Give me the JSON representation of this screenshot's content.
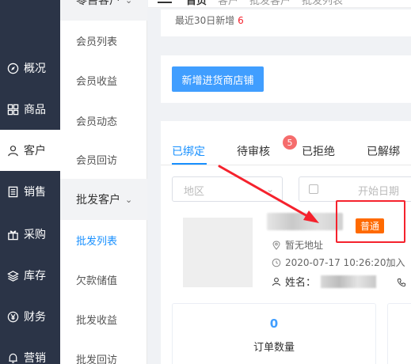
{
  "sidebar_main": {
    "items": [
      {
        "label": "概况",
        "icon": "compass-icon"
      },
      {
        "label": "商品",
        "icon": "grid-icon"
      },
      {
        "label": "客户",
        "icon": "user-icon"
      },
      {
        "label": "销售",
        "icon": "document-icon"
      },
      {
        "label": "采购",
        "icon": "gift-icon"
      },
      {
        "label": "库存",
        "icon": "layers-icon"
      },
      {
        "label": "财务",
        "icon": "yen-icon"
      },
      {
        "label": "营销",
        "icon": "bell-icon"
      }
    ],
    "active_index": 2
  },
  "sidebar_sub": {
    "group_retail": "零售客户",
    "retail_items": [
      "会员列表",
      "会员收益",
      "会员动态",
      "会员回访"
    ],
    "group_wholesale": "批发客户",
    "wholesale_items": [
      "批发列表",
      "欠款储值",
      "批发收益",
      "批发回访"
    ],
    "active_item": "批发列表"
  },
  "topbar": {
    "home": "首页",
    "crumb1": "客户",
    "crumb2": "批发客户",
    "crumb3": "批发列表"
  },
  "summary": {
    "text": "最近30日新增",
    "count": "6"
  },
  "toolbar": {
    "add_store_label": "新增进货商店铺"
  },
  "tabs": [
    {
      "label": "已绑定"
    },
    {
      "label": "待审核",
      "badge": "5"
    },
    {
      "label": "已拒绝"
    },
    {
      "label": "已解绑"
    }
  ],
  "filters": {
    "region_placeholder": "地区",
    "start_date_placeholder": "开始日期"
  },
  "store": {
    "tag": "普通",
    "address": "暂无地址",
    "created": "2020-07-17 10:26:20加入",
    "name_label": "姓名：",
    "phone_label": "电话"
  },
  "stats": [
    {
      "value": "0",
      "label": "订单数量"
    }
  ],
  "colors": {
    "sidebar_bg": "#2b3447",
    "primary": "#409eff",
    "tag_orange": "#ff6a00",
    "annotation_red": "#f5222d"
  }
}
